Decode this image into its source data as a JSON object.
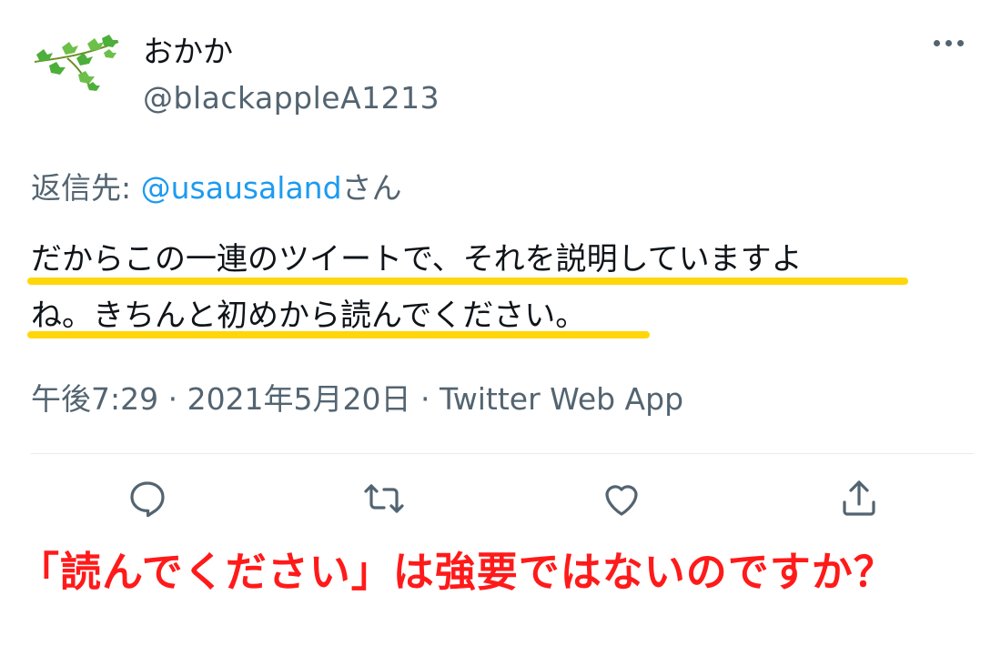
{
  "tweet": {
    "display_name": "おかか",
    "handle": "@blackappleA1213",
    "reply_to_prefix": "返信先: ",
    "reply_to_mention": "@usausaland",
    "reply_to_suffix": "さん",
    "text_line1": "だからこの一連のツイートで、それを説明していますよ",
    "text_line2": "ね。きちんと初めから読んでください。",
    "timestamp": "午後7:29 · 2021年5月20日",
    "separator": " · ",
    "source": "Twitter Web App"
  },
  "actions": {
    "reply_icon": "reply-icon",
    "retweet_icon": "retweet-icon",
    "like_icon": "heart-icon",
    "share_icon": "share-icon"
  },
  "annotation": {
    "caption": "「読んでください」は強要ではないのですか？",
    "caption_color": "#ff1a1a",
    "underline_color": "#ffd60a"
  }
}
